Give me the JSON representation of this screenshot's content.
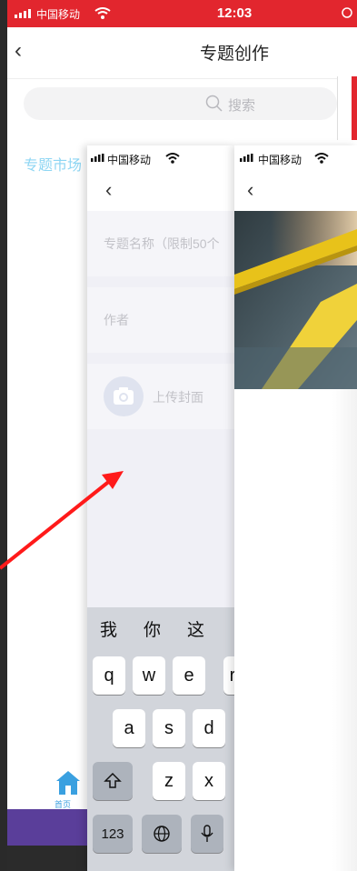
{
  "base": {
    "status_time": "12:03",
    "carrier": "中国移动",
    "title": "专题创作",
    "search_placeholder": "搜索",
    "market_label": "专题市场",
    "home_label": "首页"
  },
  "phone1": {
    "carrier": "中国移动",
    "name_placeholder": "专题名称（限制50个",
    "author_placeholder": "作者",
    "upload_label": "上传封面",
    "candidates": [
      "我",
      "你",
      "这"
    ],
    "keys_row1": [
      "q",
      "w",
      "e"
    ],
    "keys_row2": [
      "a",
      "s",
      "d"
    ],
    "keys_row3": [
      "z",
      "x"
    ],
    "key_numbers": "123"
  },
  "phone2": {
    "carrier": "中国移动"
  },
  "colors": {
    "status_red": "#e2262e",
    "annotation_red": "#ff1a1a",
    "link_blue": "#8ed6f3"
  }
}
